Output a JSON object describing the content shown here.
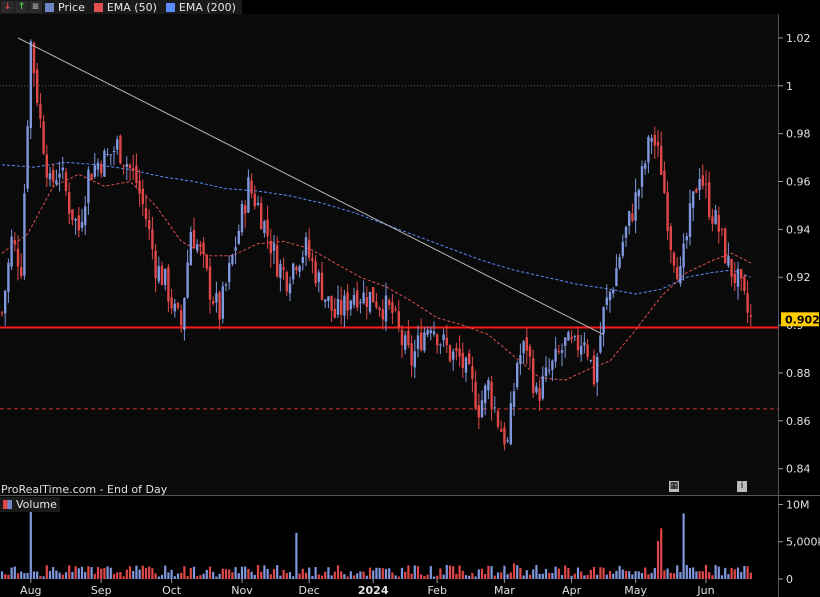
{
  "legend": {
    "items": [
      {
        "label": "Price",
        "color": "#6f86c6"
      },
      {
        "label": "EMA (50)",
        "color": "#e05050"
      },
      {
        "label": "EMA (200)",
        "color": "#5a8cff"
      }
    ],
    "tools": [
      "arrow-down-icon",
      "arrow-up-icon",
      "lines-icon"
    ]
  },
  "watermark": "ProRealTime.com - End of Day",
  "volume_label": "Volume",
  "current_price_label": "0.902",
  "colors": {
    "background": "#000000",
    "up_candle": "#7f97dd",
    "down_candle": "#e04848",
    "support_line": "#ff1a1a",
    "ema50": "#e05050",
    "ema200": "#5a8cff",
    "trendline": "#b8b8b8"
  },
  "chart_data": {
    "type": "candlestick",
    "price_axis": {
      "ticks": [
        "1.02",
        "1",
        "0.98",
        "0.96",
        "0.94",
        "0.92",
        "0.9",
        "0.88",
        "0.86",
        "0.84"
      ],
      "ylim": [
        0.829,
        1.03
      ]
    },
    "volume_axis": {
      "ticks": [
        "10M",
        "5,000k",
        "0"
      ],
      "ylim": [
        0,
        11000000
      ]
    },
    "x_tick_labels": [
      "Aug",
      "Sep",
      "Oct",
      "Nov",
      "Dec",
      "2024",
      "Feb",
      "Mar",
      "Apr",
      "May",
      "Jun"
    ],
    "x_tick_index": [
      9,
      31,
      53,
      75,
      96,
      116,
      136,
      157,
      178,
      198,
      220
    ],
    "price_path": [
      [
        0,
        0.905
      ],
      [
        3,
        0.935
      ],
      [
        6,
        0.925
      ],
      [
        9,
        1.018
      ],
      [
        12,
        0.985
      ],
      [
        15,
        0.958
      ],
      [
        18,
        0.966
      ],
      [
        21,
        0.95
      ],
      [
        24,
        0.94
      ],
      [
        27,
        0.963
      ],
      [
        30,
        0.968
      ],
      [
        33,
        0.97
      ],
      [
        36,
        0.975
      ],
      [
        39,
        0.968
      ],
      [
        42,
        0.96
      ],
      [
        45,
        0.945
      ],
      [
        48,
        0.925
      ],
      [
        51,
        0.918
      ],
      [
        54,
        0.905
      ],
      [
        56,
        0.9
      ],
      [
        59,
        0.94
      ],
      [
        62,
        0.93
      ],
      [
        65,
        0.915
      ],
      [
        68,
        0.905
      ],
      [
        71,
        0.922
      ],
      [
        74,
        0.94
      ],
      [
        77,
        0.958
      ],
      [
        80,
        0.95
      ],
      [
        83,
        0.938
      ],
      [
        86,
        0.926
      ],
      [
        89,
        0.92
      ],
      [
        92,
        0.928
      ],
      [
        95,
        0.932
      ],
      [
        98,
        0.922
      ],
      [
        101,
        0.912
      ],
      [
        104,
        0.904
      ],
      [
        107,
        0.908
      ],
      [
        110,
        0.914
      ],
      [
        113,
        0.912
      ],
      [
        116,
        0.912
      ],
      [
        119,
        0.908
      ],
      [
        122,
        0.905
      ],
      [
        125,
        0.893
      ],
      [
        128,
        0.885
      ],
      [
        131,
        0.895
      ],
      [
        134,
        0.902
      ],
      [
        137,
        0.894
      ],
      [
        140,
        0.888
      ],
      [
        143,
        0.886
      ],
      [
        146,
        0.878
      ],
      [
        149,
        0.866
      ],
      [
        152,
        0.875
      ],
      [
        155,
        0.86
      ],
      [
        158,
        0.85
      ],
      [
        161,
        0.885
      ],
      [
        164,
        0.892
      ],
      [
        167,
        0.87
      ],
      [
        170,
        0.878
      ],
      [
        173,
        0.885
      ],
      [
        176,
        0.892
      ],
      [
        179,
        0.89
      ],
      [
        182,
        0.896
      ],
      [
        185,
        0.878
      ],
      [
        188,
        0.905
      ],
      [
        191,
        0.918
      ],
      [
        194,
        0.935
      ],
      [
        197,
        0.948
      ],
      [
        200,
        0.962
      ],
      [
        203,
        0.98
      ],
      [
        206,
        0.966
      ],
      [
        209,
        0.935
      ],
      [
        212,
        0.92
      ],
      [
        215,
        0.945
      ],
      [
        218,
        0.965
      ],
      [
        221,
        0.95
      ],
      [
        224,
        0.94
      ],
      [
        227,
        0.925
      ],
      [
        230,
        0.918
      ],
      [
        233,
        0.905
      ],
      [
        234,
        0.902
      ]
    ],
    "ema50_path": [
      [
        0,
        0.93
      ],
      [
        8,
        0.938
      ],
      [
        16,
        0.958
      ],
      [
        24,
        0.963
      ],
      [
        32,
        0.958
      ],
      [
        40,
        0.96
      ],
      [
        48,
        0.95
      ],
      [
        56,
        0.935
      ],
      [
        64,
        0.929
      ],
      [
        72,
        0.929
      ],
      [
        80,
        0.934
      ],
      [
        88,
        0.935
      ],
      [
        96,
        0.932
      ],
      [
        104,
        0.926
      ],
      [
        112,
        0.92
      ],
      [
        120,
        0.916
      ],
      [
        128,
        0.91
      ],
      [
        136,
        0.903
      ],
      [
        144,
        0.9
      ],
      [
        152,
        0.896
      ],
      [
        160,
        0.887
      ],
      [
        168,
        0.878
      ],
      [
        176,
        0.877
      ],
      [
        184,
        0.882
      ],
      [
        190,
        0.885
      ],
      [
        198,
        0.898
      ],
      [
        206,
        0.912
      ],
      [
        214,
        0.922
      ],
      [
        222,
        0.927
      ],
      [
        228,
        0.93
      ],
      [
        234,
        0.926
      ]
    ],
    "ema200_path": [
      [
        0,
        0.967
      ],
      [
        10,
        0.966
      ],
      [
        20,
        0.968
      ],
      [
        30,
        0.967
      ],
      [
        40,
        0.965
      ],
      [
        50,
        0.962
      ],
      [
        60,
        0.96
      ],
      [
        70,
        0.957
      ],
      [
        80,
        0.956
      ],
      [
        90,
        0.954
      ],
      [
        100,
        0.951
      ],
      [
        110,
        0.947
      ],
      [
        120,
        0.942
      ],
      [
        130,
        0.937
      ],
      [
        140,
        0.932
      ],
      [
        150,
        0.927
      ],
      [
        160,
        0.923
      ],
      [
        170,
        0.92
      ],
      [
        180,
        0.917
      ],
      [
        190,
        0.915
      ],
      [
        198,
        0.913
      ],
      [
        206,
        0.915
      ],
      [
        214,
        0.92
      ],
      [
        222,
        0.922
      ],
      [
        228,
        0.923
      ],
      [
        234,
        0.92
      ]
    ],
    "trendline": [
      [
        5,
        1.02
      ],
      [
        188,
        0.896
      ]
    ],
    "support_level": 0.899,
    "dashed_level": 0.865,
    "dotted_level": 1.0,
    "volume_spikes": [
      [
        9,
        9.5
      ],
      [
        92,
        6.2
      ],
      [
        160,
        2.1
      ],
      [
        205,
        5.1
      ],
      [
        206,
        6.8
      ],
      [
        213,
        8.8
      ]
    ],
    "volume_base": 1.3
  }
}
